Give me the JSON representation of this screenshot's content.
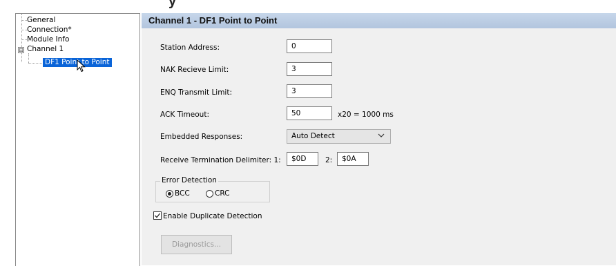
{
  "window": {
    "cutoff_title": "y"
  },
  "tree": {
    "items": [
      {
        "label": "General"
      },
      {
        "label": "Connection*"
      },
      {
        "label": "Module Info"
      },
      {
        "label": "Channel 1",
        "expander": "⊟"
      },
      {
        "label": "DF1 Point to Point",
        "selected": true
      }
    ]
  },
  "panel": {
    "title": "Channel 1 - DF1 Point to Point",
    "station_address": {
      "label": "Station Address:",
      "value": "0"
    },
    "nak_limit": {
      "label": "NAK Recieve Limit:",
      "value": "3"
    },
    "enq_limit": {
      "label": "ENQ Transmit Limit:",
      "value": "3"
    },
    "ack_timeout": {
      "label": "ACK Timeout:",
      "value": "50",
      "unit": "x20 = 1000 ms"
    },
    "embedded": {
      "label": "Embedded Responses:",
      "value": "Auto Detect"
    },
    "delimiter": {
      "label": "Receive Termination Delimiter:  1:",
      "value1": "$0D",
      "label2": "2:",
      "value2": "$0A"
    },
    "error_detection": {
      "legend": "Error Detection",
      "options": [
        {
          "label": "BCC",
          "selected": true
        },
        {
          "label": "CRC",
          "selected": false
        }
      ]
    },
    "duplicate": {
      "label": "Enable Duplicate Detection",
      "checked": true
    },
    "diagnostics_button": "Diagnostics..."
  },
  "colors": {
    "selection": "#0a64d8",
    "header_gradient_top": "#c6d6ea",
    "panel_bg": "#f0f0f0"
  }
}
